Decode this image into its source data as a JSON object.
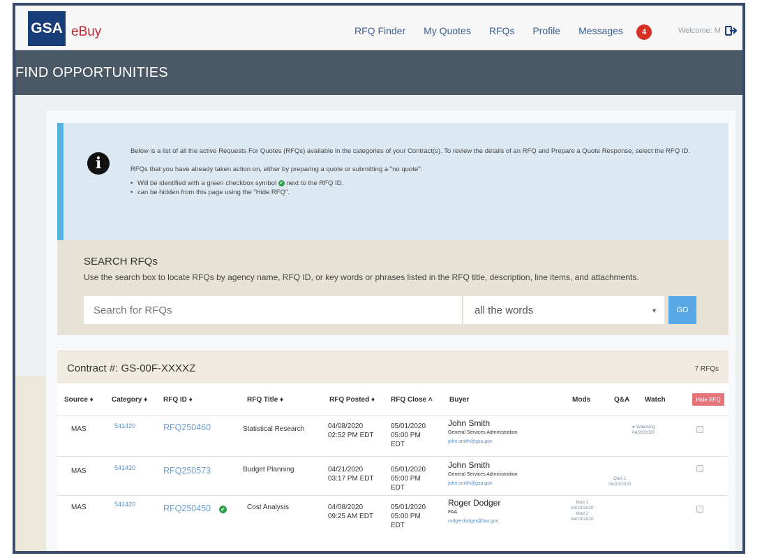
{
  "nav": {
    "logo_gsa": "GSA",
    "logo_ebuy": "eBuy",
    "links": [
      "RFQ Finder",
      "My Quotes",
      "RFQs",
      "Profile",
      "Messages"
    ],
    "messages_badge": "4",
    "welcome": "Welcome: M",
    "logout_icon": "logout-icon"
  },
  "page_title": "FIND OPPORTUNITIES",
  "info": {
    "icon": "info-icon",
    "para1": "Below is a list of all the active Requests For Quotes (RFQs) available in the categories of your Contract(s). To review the details of an RFQ and Prepare a Quote Response, select the RFQ ID.",
    "para2": "RFQs that you have already taken action on, either by preparing a quote or submitting a \"no quote\":",
    "bullet1_pre": "Will be identified with a green checkbox symbol",
    "bullet1_post": "next to the RFQ ID.",
    "bullet2": "can be hidden from this page using the \"Hide RFQ\"."
  },
  "search": {
    "heading": "SEARCH RFQs",
    "description": "Use the search box to locate RFQs by agency name, RFQ ID, or key words or phrases listed in the RFQ title, description, line items, and attachments.",
    "placeholder": "Search for RFQs",
    "match_option": "all the words",
    "go_label": "GO"
  },
  "contract": {
    "number": "Contract #: GS-00F-XXXXZ",
    "rfq_count": "7 RFQs",
    "headers": {
      "source": "Source ♦",
      "category": "Category ♦",
      "rfq_id": "RFQ ID ♦",
      "title": "RFQ Title ♦",
      "posted": "RFQ Posted ♦",
      "close": "RFQ Close ˄",
      "buyer": "Buyer",
      "mods": "Mods",
      "qa": "Q&A",
      "watch": "Watch"
    },
    "hide_button": "Hide RFQ",
    "rows": [
      {
        "source": "MAS",
        "category": "541420",
        "rfq_id": "RFQ250460",
        "title": "Statistical Research",
        "posted_date": "04/08/2020",
        "posted_time": "02:52 PM EDT",
        "close_date": "05/01/2020",
        "close_time": "05:00 PM",
        "close_tz": "EDT",
        "buyer_name": "John Smith",
        "buyer_org": "General Services Administration",
        "buyer_email": "john.smith@gsa.gov",
        "watch_label": "● Watching",
        "watch_date": "04/20/2020"
      },
      {
        "source": "MAS",
        "category": "541420",
        "rfq_id": "RFQ250573",
        "title": "Budget Planning",
        "posted_date": "04/21/2020",
        "posted_time": "03:17 PM EDT",
        "close_date": "05/01/2020",
        "close_time": "05:00 PM",
        "close_tz": "EDT",
        "buyer_name": "John Smith",
        "buyer_org": "General Services Administration",
        "buyer_email": "john.smith@gsa.gov",
        "qa_label": "Q&A 1",
        "qa_date": "04/20/2020"
      },
      {
        "source": "MAS",
        "category": "541420",
        "rfq_id": "RFQ250450",
        "title": "Cost Analysis",
        "posted_date": "04/08/2020",
        "posted_time": "09:25 AM EDT",
        "close_date": "05/01/2020",
        "close_time": "05:00 PM",
        "close_tz": "EDT",
        "buyer_name": "Roger Dodger",
        "buyer_org": "FAA",
        "buyer_email": "rodgerdodger@faa.gov",
        "mod1_label": "Mod 1",
        "mod1_date": "04/10/2020",
        "mod2_label": "Mod 2",
        "mod2_date": "04/10/2020"
      }
    ]
  },
  "colors": {
    "brand_blue": "#173c78",
    "ebuy_red": "#c0262d",
    "title_bar": "#4a5866",
    "info_bg": "#dde9f2",
    "search_bg": "#e7e2d6",
    "go_button": "#58a7e6",
    "hide_button": "#e4737a",
    "check_green": "#2e9e48"
  }
}
